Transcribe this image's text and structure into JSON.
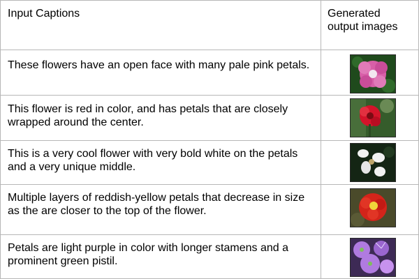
{
  "header": {
    "col_input": "Input Captions",
    "col_output": "Generated output images"
  },
  "rows": [
    {
      "caption": "These flowers have an open face with many pale pink petals.",
      "image_icon": "pink-flower-image",
      "colors": {
        "bg": "#1f4a1c",
        "petal": "#d85fa8",
        "center": "#f2e6f0"
      }
    },
    {
      "caption": "This flower is red in color, and has petals that are closely wrapped around the center.",
      "image_icon": "red-flower-image",
      "colors": {
        "bg": "#355c2b",
        "petal": "#d4142a",
        "center": "#7a0b13"
      }
    },
    {
      "caption": "This is a very cool flower with very bold white on the petals and a very unique middle.",
      "image_icon": "white-flower-image",
      "colors": {
        "bg": "#142514",
        "petal": "#f2f2f2",
        "center": "#bda56a"
      }
    },
    {
      "caption": "Multiple layers of reddish-yellow petals that decrease in size as the are closer to the top of the flower.",
      "image_icon": "red-yellow-flower-image",
      "colors": {
        "bg": "#4a4a2a",
        "petal": "#d3241a",
        "center": "#f0d43a"
      }
    },
    {
      "caption": "Petals are light purple in color with longer stamens and a prominent green pistil.",
      "image_icon": "purple-flower-image",
      "colors": {
        "bg": "#3d2a55",
        "petal": "#b07be0",
        "center": "#7fbf5a"
      }
    }
  ]
}
